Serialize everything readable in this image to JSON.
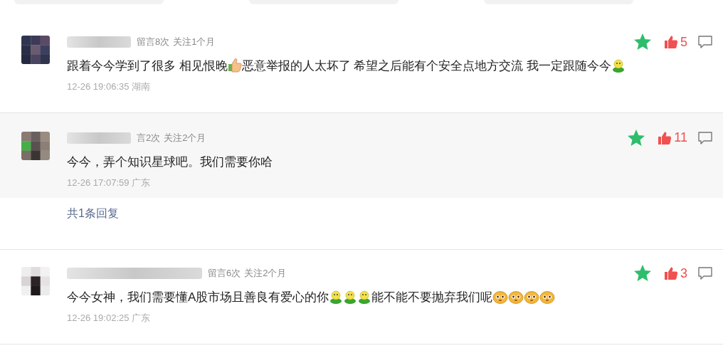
{
  "tabs": [
    {
      "kind": "pill"
    },
    {
      "kind": "pill"
    },
    {
      "kind": "pill"
    }
  ],
  "comments": [
    {
      "meta": [
        "留言8次",
        "关注1个月"
      ],
      "content": [
        {
          "kind": "text",
          "text": "跟着今今学到了很多 相见恨晚"
        },
        {
          "kind": "thumb"
        },
        {
          "kind": "text",
          "text": "恶意举报的人太坏了 希望之后能有个安全点地方交流 我一定跟随今今"
        },
        {
          "kind": "figure"
        }
      ],
      "time": "12-26 19:06:35 湖南",
      "starred": true,
      "liked": true,
      "likes": "5",
      "highlighted": false
    },
    {
      "meta": [
        "言2次",
        "关注2个月"
      ],
      "content": [
        {
          "kind": "text",
          "text": "今今，弄个知识星球吧。我们需要你哈"
        }
      ],
      "time": "12-26 17:07:59 广东",
      "starred": true,
      "liked": true,
      "likes": "11",
      "highlighted": true,
      "replies": "共1条回复"
    },
    {
      "meta": [
        "留言6次",
        "关注2个月"
      ],
      "content": [
        {
          "kind": "text",
          "text": "今今女神，我们需要懂A股市场且善良有爱心的你"
        },
        {
          "kind": "figure"
        },
        {
          "kind": "figure"
        },
        {
          "kind": "figure"
        },
        {
          "kind": "text",
          "text": "能不能不要抛弃我们呢"
        },
        {
          "kind": "face"
        },
        {
          "kind": "face"
        },
        {
          "kind": "face"
        },
        {
          "kind": "face"
        }
      ],
      "time": "12-26 19:02:25 广东",
      "starred": true,
      "liked": true,
      "likes": "3",
      "highlighted": false
    }
  ]
}
